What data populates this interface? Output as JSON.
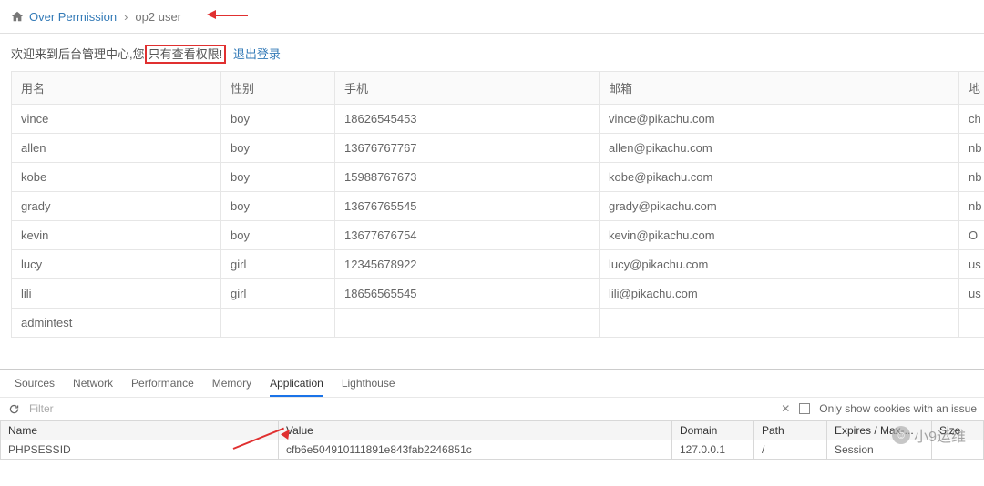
{
  "breadcrumb": {
    "home_icon": "home-icon",
    "link1": "Over Permission",
    "sep": "›",
    "current": "op2 user"
  },
  "welcome": {
    "prefix": "欢迎来到后台管理中心,您",
    "boxed": "只有查看权限!",
    "logout": "退出登录"
  },
  "table": {
    "headers": [
      "用名",
      "性别",
      "手机",
      "邮箱",
      "地"
    ],
    "rows": [
      {
        "name": "vince",
        "gender": "boy",
        "phone": "18626545453",
        "email": "vince@pikachu.com",
        "addr": "ch"
      },
      {
        "name": "allen",
        "gender": "boy",
        "phone": "13676767767",
        "email": "allen@pikachu.com",
        "addr": "nb"
      },
      {
        "name": "kobe",
        "gender": "boy",
        "phone": "15988767673",
        "email": "kobe@pikachu.com",
        "addr": "nb"
      },
      {
        "name": "grady",
        "gender": "boy",
        "phone": "13676765545",
        "email": "grady@pikachu.com",
        "addr": "nb"
      },
      {
        "name": "kevin",
        "gender": "boy",
        "phone": "13677676754",
        "email": "kevin@pikachu.com",
        "addr": "O"
      },
      {
        "name": "lucy",
        "gender": "girl",
        "phone": "12345678922",
        "email": "lucy@pikachu.com",
        "addr": "us"
      },
      {
        "name": "lili",
        "gender": "girl",
        "phone": "18656565545",
        "email": "lili@pikachu.com",
        "addr": "us"
      },
      {
        "name": "admintest",
        "gender": "",
        "phone": "",
        "email": "",
        "addr": ""
      }
    ]
  },
  "devtools": {
    "tabs": [
      "Sources",
      "Network",
      "Performance",
      "Memory",
      "Application",
      "Lighthouse"
    ],
    "active_tab": "Application",
    "filter_placeholder": "Filter",
    "only_issue_label": "Only show cookies with an issue",
    "cookie_headers": [
      "Name",
      "Value",
      "Domain",
      "Path",
      "Expires / Max-...",
      "Size"
    ],
    "cookies": [
      {
        "name": "PHPSESSID",
        "value": "cfb6e504910111891e843fab2246851c",
        "domain": "127.0.0.1",
        "path": "/",
        "expires": "Session",
        "size": ""
      }
    ]
  },
  "watermark": "小9运维"
}
